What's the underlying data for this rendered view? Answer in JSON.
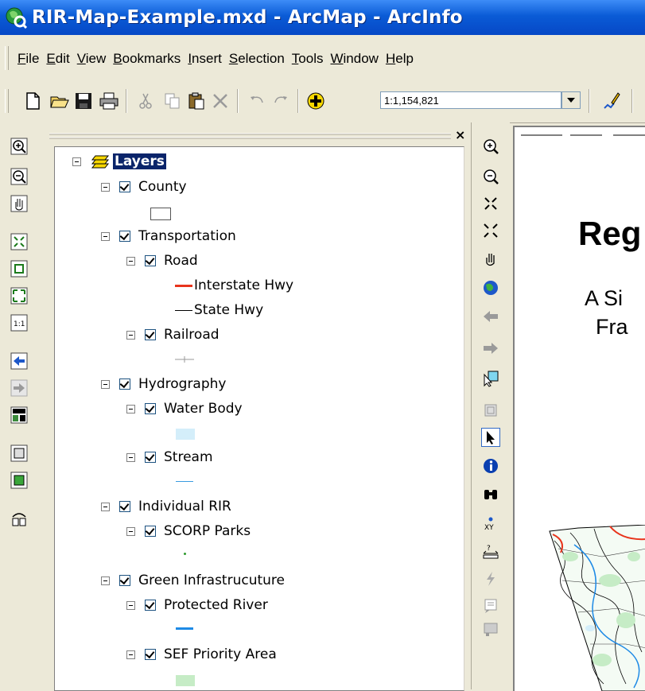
{
  "window": {
    "title": "RIR-Map-Example.mxd - ArcMap - ArcInfo"
  },
  "menu": [
    "File",
    "Edit",
    "View",
    "Bookmarks",
    "Insert",
    "Selection",
    "Tools",
    "Window",
    "Help"
  ],
  "toolbar": {
    "scale_value": "1:1,154,821"
  },
  "toc": {
    "close_label": "×",
    "items": [
      {
        "label": "Layers",
        "level": 0,
        "type": "frame"
      },
      {
        "label": "County",
        "level": 1
      },
      {
        "label": "Transportation",
        "level": 1
      },
      {
        "label": "Road",
        "level": 2
      },
      {
        "label": "Interstate Hwy",
        "level": 3,
        "type": "legend"
      },
      {
        "label": "State Hwy",
        "level": 3,
        "type": "legend"
      },
      {
        "label": "Railroad",
        "level": 2
      },
      {
        "label": "Hydrography",
        "level": 1
      },
      {
        "label": "Water Body",
        "level": 2
      },
      {
        "label": "Stream",
        "level": 2
      },
      {
        "label": "Individual RIR",
        "level": 1
      },
      {
        "label": "SCORP Parks",
        "level": 2
      },
      {
        "label": "Green Infrastrucuture",
        "level": 1
      },
      {
        "label": "Protected River",
        "level": 2
      },
      {
        "label": "SEF Priority Area",
        "level": 2
      }
    ]
  },
  "map": {
    "title_fragment": "Reg",
    "subtitle_line1": "A Si",
    "subtitle_line2": "Fra"
  },
  "colors": {
    "interstate": "#e8341c",
    "state_hwy": "#000000",
    "water_body": "#d4eefa",
    "stream": "#3a9be0",
    "protected_river": "#1e8ae6",
    "sef_priority": "#c6ecc6",
    "scorp": "#2e9a2e",
    "layers_highlight": "#0a246a"
  }
}
